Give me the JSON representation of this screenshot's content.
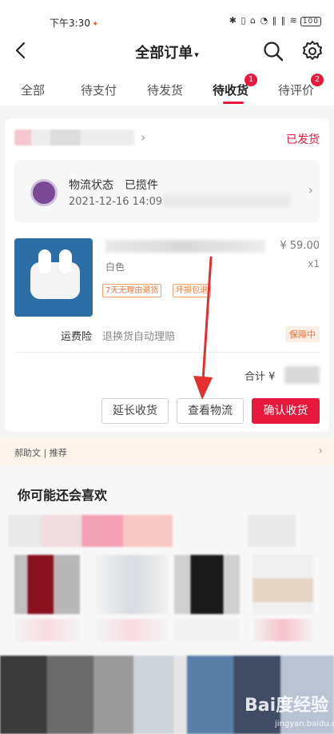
{
  "status_bar": {
    "time": "下午3:30",
    "icons": "✱ ▯ ⌂ ◔ ‖ ‖ ≋",
    "battery": "100"
  },
  "header": {
    "title": "全部订单",
    "title_caret": "▾"
  },
  "tabs": [
    {
      "label": "全部"
    },
    {
      "label": "待支付"
    },
    {
      "label": "待发货"
    },
    {
      "label": "待收货",
      "badge": "1",
      "active": true
    },
    {
      "label": "待评价",
      "badge": "2"
    }
  ],
  "order": {
    "status": "已发货",
    "logistics": {
      "label": "物流状态",
      "status": "已揽件",
      "date": "2021-12-16 14:09"
    },
    "product": {
      "price": "¥ 59.00",
      "qty": "x1",
      "variant": "白色",
      "tags": [
        "7天无理由退货",
        "坏损包退"
      ]
    },
    "insurance": {
      "label": "运费险",
      "desc": "退换货自动理赔",
      "badge": "保障中"
    },
    "total_label": "合计 ¥",
    "buttons": {
      "extend": "延长收货",
      "logistics": "查看物流",
      "confirm": "确认收货"
    }
  },
  "recommend_bar": {
    "text": "郝助文 | 推荐",
    "chevron": "›"
  },
  "likes": {
    "title": "你可能还会喜欢"
  },
  "watermark": {
    "brand": "Bai度经验",
    "url": "jingyan.baidu.com"
  },
  "colors": {
    "accent": "#e8173c",
    "tag": "#e8753a"
  }
}
